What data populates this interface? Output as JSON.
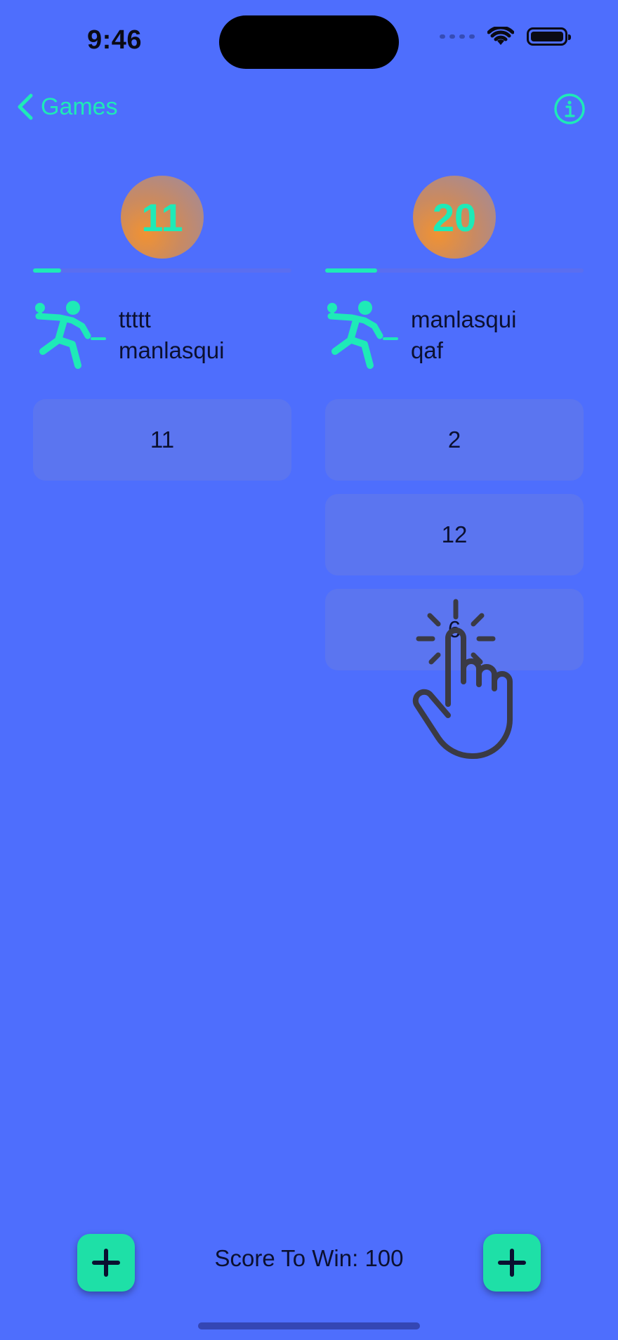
{
  "status_bar": {
    "time": "9:46"
  },
  "nav": {
    "back_label": "Games"
  },
  "players": [
    {
      "score": "11",
      "progress_fraction": 0.11,
      "name_line1": "ttttt",
      "name_line2": "manlasqui",
      "rounds": [
        "11"
      ]
    },
    {
      "score": "20",
      "progress_fraction": 0.2,
      "name_line1": "manlasqui",
      "name_line2": "qaf",
      "rounds": [
        "2",
        "12",
        "6"
      ]
    }
  ],
  "footer": {
    "score_to_win": "Score To Win: 100"
  },
  "colors": {
    "background": "#4E6EFD",
    "accent": "#1EEAB7",
    "button": "#1EE0A7"
  },
  "icons": {
    "team": "ping-pong-player-icon",
    "add": "plus-icon",
    "info": "info-icon",
    "back": "chevron-left-icon",
    "tap": "tap-hand-icon"
  }
}
